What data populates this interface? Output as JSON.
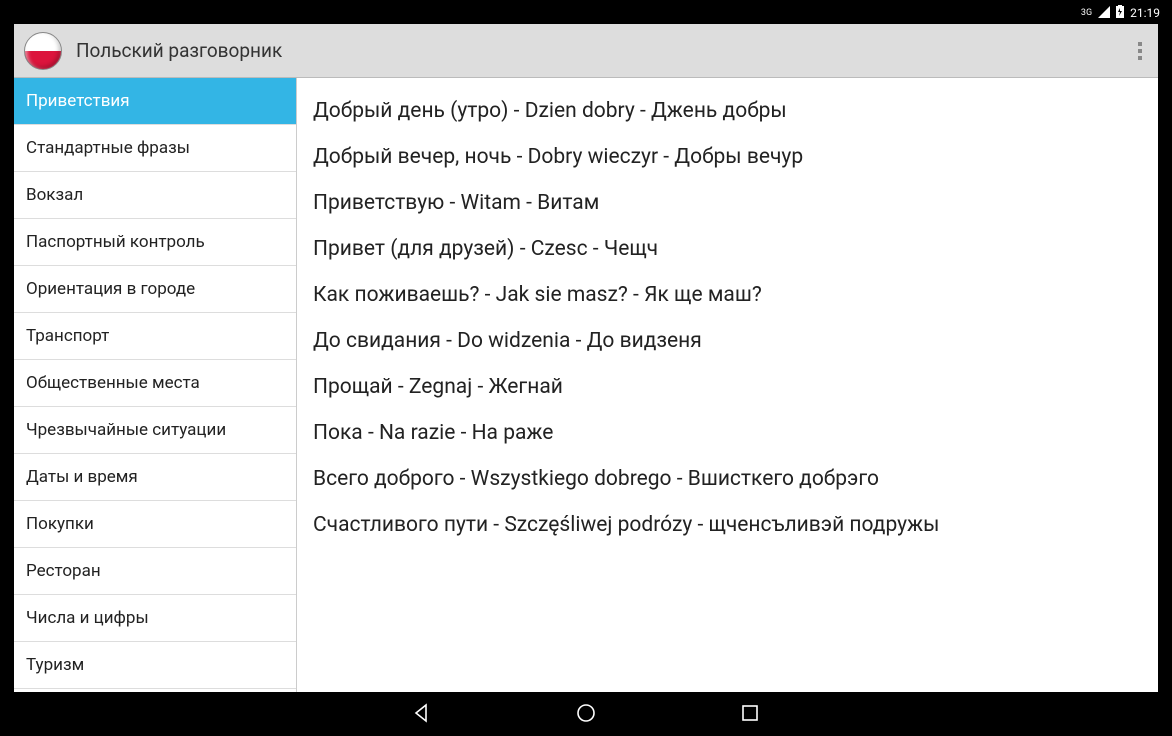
{
  "status": {
    "network": "3G",
    "time": "21:19"
  },
  "header": {
    "title": "Польский разговорник"
  },
  "sidebar": {
    "items": [
      {
        "label": "Приветствия",
        "active": true
      },
      {
        "label": "Стандартные фразы",
        "active": false
      },
      {
        "label": "Вокзал",
        "active": false
      },
      {
        "label": "Паспортный контроль",
        "active": false
      },
      {
        "label": "Ориентация в городе",
        "active": false
      },
      {
        "label": "Транспорт",
        "active": false
      },
      {
        "label": "Общественные места",
        "active": false
      },
      {
        "label": "Чрезвычайные ситуации",
        "active": false
      },
      {
        "label": "Даты и время",
        "active": false
      },
      {
        "label": "Покупки",
        "active": false
      },
      {
        "label": "Ресторан",
        "active": false
      },
      {
        "label": "Числа и цифры",
        "active": false
      },
      {
        "label": "Туризм",
        "active": false
      }
    ]
  },
  "phrases": [
    "Добрый день (утро) - Dzien dobry - Джень добры",
    "Добрый вечер, ночь - Dobry wieczyr - Добры вечур",
    "Приветствую - Witam - Витам",
    "Привет (для друзей) - Czesc - Чещч",
    "Как поживаешь? - Jak sie masz? - Як ще маш?",
    "До свидания - Do widzenia - До видзеня",
    "Прощай - Zegnaj - Жегнай",
    "Пока - Na razie - На раже",
    "Всего доброго - Wszystkiego dobrego - Вшисткего добрэго",
    "Счастливого пути - Szczęśliwej podrózy - щченсъливэй подружы"
  ]
}
